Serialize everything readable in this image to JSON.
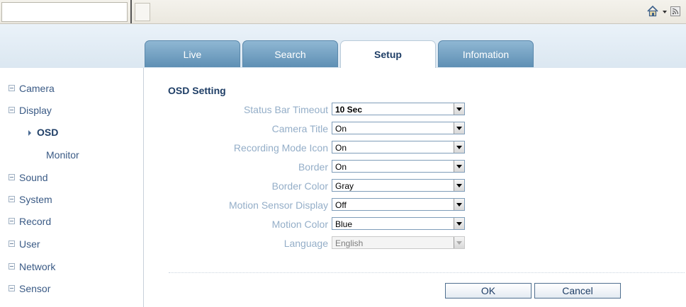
{
  "tabs": [
    {
      "label": "Live",
      "active": false
    },
    {
      "label": "Search",
      "active": false
    },
    {
      "label": "Setup",
      "active": true
    },
    {
      "label": "Infomation",
      "active": false
    }
  ],
  "sidebar": {
    "items": [
      {
        "label": "Camera"
      },
      {
        "label": "Display",
        "subitems": [
          {
            "label": "OSD",
            "active": true
          },
          {
            "label": "Monitor",
            "active": false
          }
        ]
      },
      {
        "label": "Sound"
      },
      {
        "label": "System"
      },
      {
        "label": "Record"
      },
      {
        "label": "User"
      },
      {
        "label": "Network"
      },
      {
        "label": "Sensor"
      }
    ]
  },
  "osd": {
    "title": "OSD Setting",
    "rows": [
      {
        "label": "Status Bar Timeout",
        "value": "10 Sec"
      },
      {
        "label": "Camera Title",
        "value": "On"
      },
      {
        "label": "Recording Mode Icon",
        "value": "On"
      },
      {
        "label": "Border",
        "value": "On"
      },
      {
        "label": "Border Color",
        "value": "Gray"
      },
      {
        "label": "Motion Sensor Display",
        "value": "Off"
      },
      {
        "label": "Motion Color",
        "value": "Blue"
      },
      {
        "label": "Language",
        "value": "English",
        "disabled": true
      }
    ]
  },
  "buttons": {
    "ok": "OK",
    "cancel": "Cancel"
  },
  "colors": {
    "accent": "#1f3e66",
    "tab_inactive": "#6f9cc0",
    "label": "#94aec8"
  },
  "icons": [
    "home-icon",
    "dropdown-arrow-icon",
    "rss-feed-icon"
  ]
}
